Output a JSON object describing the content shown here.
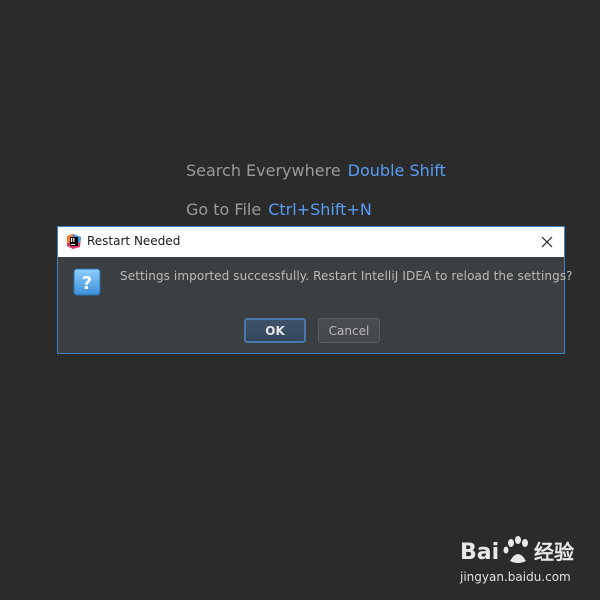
{
  "hints": {
    "search_label": "Search Everywhere",
    "search_shortcut": "Double Shift",
    "goto_label": "Go to File",
    "goto_shortcut": "Ctrl+Shift+N"
  },
  "dialog": {
    "title": "Restart Needed",
    "app_icon": "intellij-idea-icon",
    "message_icon": "question-icon",
    "message": "Settings imported successfully. Restart IntelliJ IDEA to reload the settings?",
    "ok_label": "OK",
    "cancel_label": "Cancel",
    "close_icon": "close-icon"
  },
  "watermark": {
    "logo": "Bai  经验",
    "url": "jingyan.baidu.com"
  },
  "colors": {
    "background": "#2b2b2b",
    "accent": "#589df6",
    "dialog_border": "#3b82c4"
  }
}
